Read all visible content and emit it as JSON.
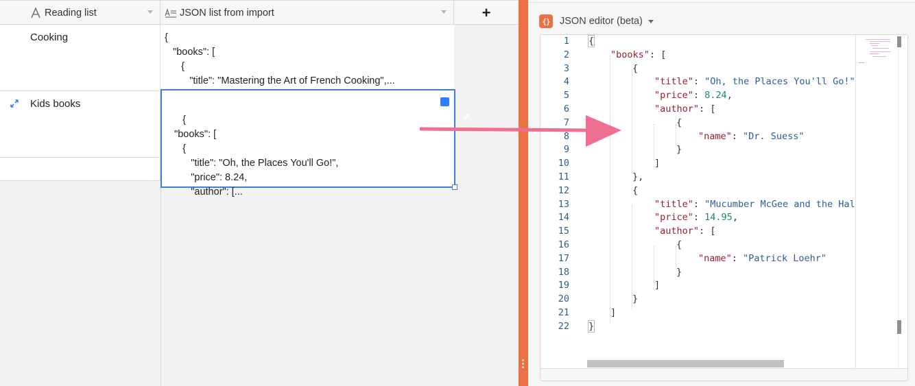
{
  "grid": {
    "header": {
      "col1_label": "Reading list",
      "col2_label": "JSON list from import",
      "add_symbol": "+"
    },
    "rows": [
      {
        "name": "Cooking",
        "json_preview": "{\n   \"books\": [\n      {\n         \"title\": \"Mastering the Art of French Cooking\",..."
      },
      {
        "name": "Kids books",
        "json_preview": "{\n   \"books\": [\n      {\n         \"title\": \"Oh, the Places You'll Go!\",\n         \"price\": 8.24,\n         \"author\": [..."
      }
    ]
  },
  "panel": {
    "title": "JSON editor (beta)",
    "icon_glyph": "{}",
    "line_numbers": [
      "1",
      "2",
      "3",
      "4",
      "5",
      "6",
      "7",
      "8",
      "9",
      "10",
      "11",
      "12",
      "13",
      "14",
      "15",
      "16",
      "17",
      "18",
      "19",
      "20",
      "21",
      "22"
    ],
    "code": {
      "l1": "{",
      "books_key": "\"books\"",
      "l2_tail": ": [",
      "open_brace": "{",
      "title_key": "\"title\"",
      "title1": "\"Oh, the Places You'll Go!\"",
      "price_key": "\"price\"",
      "price1": "8.24",
      "author_key": "\"author\"",
      "author_tail": ": [",
      "name_key": "\"name\"",
      "name1": "\"Dr. Suess\"",
      "close_brace": "}",
      "close_bracket": "]",
      "close_brace_comma": "},",
      "title2": "\"Mucumber McGee and the Half-",
      "price2": "14.95",
      "name2": "\"Patrick Loehr\"",
      "colon": ": ",
      "comma": ","
    }
  },
  "colors": {
    "accent": "#eb7142",
    "selection": "#3f7fdb",
    "arrow": "#ee6f92",
    "json_key": "#a11b2a",
    "json_string": "#2b5d9a",
    "json_number": "#1a8a5a",
    "line_number": "#2b5d8c"
  },
  "icons": {
    "col1": "text-field-icon",
    "col2": "long-text-icon",
    "row_expand": "expand-arrows-icon",
    "cell_expand": "expand-cell-icon",
    "panel": "json-braces-icon",
    "dropdown": "chevron-down-icon"
  }
}
